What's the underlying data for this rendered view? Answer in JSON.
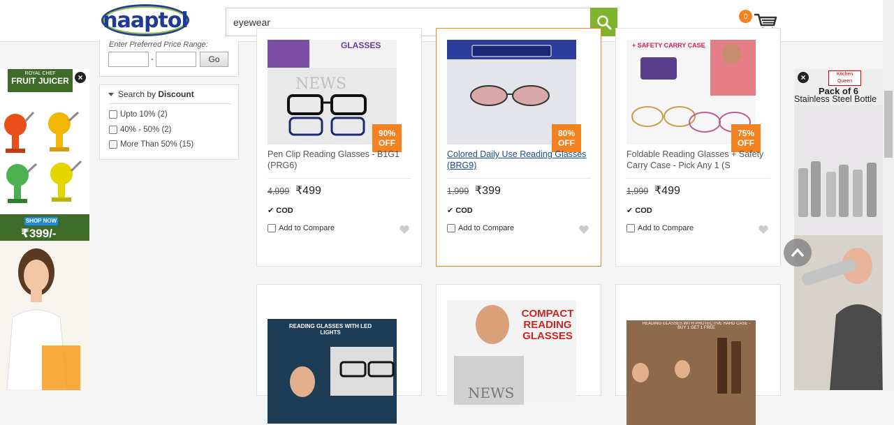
{
  "header": {
    "logo_text": "naaptol",
    "search_value": "eyewear",
    "cart_count": "0"
  },
  "filters": {
    "price_label": "Enter Preferred Price Range:",
    "dash": "-",
    "go_label": "Go",
    "discount_title_prefix": "Search by",
    "discount_title_bold": "Discount",
    "options": [
      "Upto 10% (2)",
      "40% - 50% (2)",
      "More Than 50% (15)"
    ]
  },
  "left_ad": {
    "brand": "ROYAL CHEF",
    "title": "FRUIT JUICER",
    "cta": "SHOP NOW",
    "price": "₹399/-"
  },
  "right_ad": {
    "brand": "Kitchen Queen",
    "title": "Pack of 6",
    "subtitle": "Stainless Steel Bottle"
  },
  "products": [
    {
      "title": "Pen Clip Reading Glasses - B1G1 (PRG6)",
      "mrp": "4,999",
      "price": "₹499",
      "off": "90%",
      "off_label": "OFF",
      "cod": "COD",
      "compare": "Add to Compare",
      "img_text": "GLASSES"
    },
    {
      "title": "Colored Daily Use Reading Glasses (BRG9)",
      "mrp": "1,999",
      "price": "₹399",
      "off": "80%",
      "off_label": "OFF",
      "cod": "COD",
      "compare": "Add to Compare",
      "img_text": ""
    },
    {
      "title": "Foldable Reading Glasses + Safety Carry Case - Pick Any 1 (S",
      "mrp": "1,999",
      "price": "₹499",
      "off": "75%",
      "off_label": "OFF",
      "cod": "COD",
      "compare": "Add to Compare",
      "img_text": "+ SAFETY CARRY CASE"
    },
    {
      "img_text": "READING GLASSES WITH LED LIGHTS"
    },
    {
      "img_text": "COMPACT READING GLASSES"
    },
    {
      "img_text": "READING GLASSES WITH PROTECTIVE HARD CASE - BUY 1 GET 1 FREE"
    }
  ]
}
